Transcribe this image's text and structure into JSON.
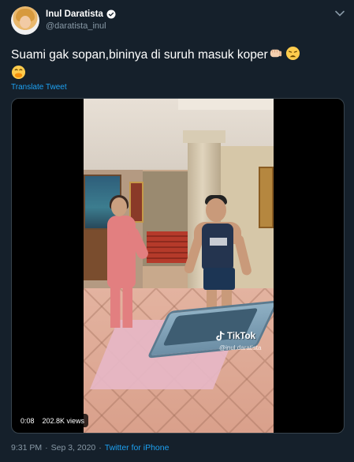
{
  "author": {
    "display_name": "Inul Daratista",
    "handle": "@daratista_inul",
    "verified": true
  },
  "tweet": {
    "text": "Suami gak sopan,bininya di suruh masuk koper",
    "emojis": [
      "oncoming-fist",
      "weary-face",
      "face-with-hand-over-mouth"
    ],
    "translate_label": "Translate Tweet"
  },
  "media": {
    "watermark_brand": "TikTok",
    "watermark_user": "@inul.daratista",
    "duration": "0:08",
    "views": "202.8K views"
  },
  "meta": {
    "time": "9:31 PM",
    "separator": "·",
    "date": "Sep 3, 2020",
    "source": "Twitter for iPhone"
  },
  "colors": {
    "background": "#15202b",
    "accent": "#1da1f2",
    "secondary_text": "#8899a6"
  }
}
